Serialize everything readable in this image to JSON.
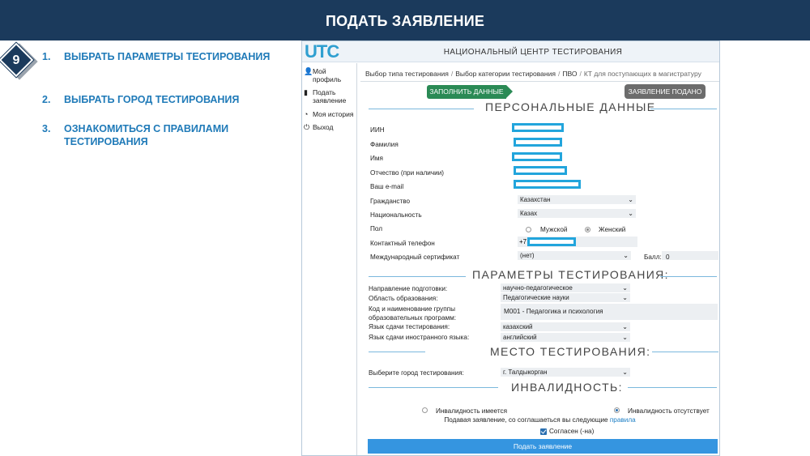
{
  "slide": {
    "title": "ПОДАТЬ ЗАЯВЛЕНИЕ",
    "step_number": "9",
    "steps": [
      {
        "num": "1.",
        "text": "ВЫБРАТЬ ПАРАМЕТРЫ ТЕСТИРОВАНИЯ"
      },
      {
        "num": "2.",
        "text": "ВЫБРАТЬ ГОРОД ТЕСТИРОВАНИЯ"
      },
      {
        "num": "3.",
        "text": "ОЗНАКОМИТЬСЯ С ПРАВИЛАМИ ТЕСТИРОВАНИЯ"
      }
    ],
    "accent_color": "#1b3a5c",
    "step_color": "#1f7ab8"
  },
  "app": {
    "logo": "UTC",
    "header_title": "НАЦИОНАЛЬНЫЙ ЦЕНТР ТЕСТИРОВАНИЯ",
    "sidebar": [
      {
        "icon": "user-icon",
        "glyph": "👤",
        "label": "Мой профиль"
      },
      {
        "icon": "document-icon",
        "glyph": "▮",
        "label": "Подать заявление"
      },
      {
        "icon": "history-icon",
        "glyph": "◔",
        "label": "Моя история"
      },
      {
        "icon": "power-icon",
        "glyph": "⏻",
        "label": "Выход"
      }
    ],
    "breadcrumbs": [
      "Выбор типа тестирования",
      "Выбор категории тестирования",
      "ПВО",
      "КТ для поступающих в магистратуру"
    ],
    "btn_fill": "ЗАПОЛНИТЬ ДАННЫЕ",
    "btn_submitted": "ЗАЯВЛЕНИЕ ПОДАНО",
    "personal": {
      "title": "ПЕРСОНАЛЬНЫЕ ДАННЫЕ",
      "iin_label": "ИИН",
      "surname_label": "Фамилия",
      "name_label": "Имя",
      "patronymic_label": "Отчество (при наличии)",
      "email_label": "Ваш e-mail",
      "citizenship_label": "Гражданство",
      "citizenship_value": "Казахстан",
      "nationality_label": "Национальность",
      "nationality_value": "Казах",
      "gender_label": "Пол",
      "gender_male": "Мужской",
      "gender_female": "Женский",
      "phone_label": "Контактный телефон",
      "phone_prefix": "+7",
      "cert_label": "Международный сертификат",
      "cert_value": "(нет)",
      "score_label": "Балл:",
      "score_value": "0"
    },
    "params": {
      "title": "ПАРАМЕТРЫ ТЕСТИРОВАНИЯ:",
      "direction_label": "Направление подготовки:",
      "direction_value": "научно-педагогическое",
      "area_label": "Область образования:",
      "area_value": "Педагогические науки",
      "group_label_1": "Код и наименование группы",
      "group_label_2": "образовательных программ:",
      "group_value": "M001 - Педагогика и психология",
      "lang_label": "Язык сдачи тестирования:",
      "lang_value": "казахский",
      "foreign_label": "Язык сдачи иностранного языка:",
      "foreign_value": "английский"
    },
    "place": {
      "title": "МЕСТО ТЕСТИРОВАНИЯ:",
      "city_label": "Выберите город тестирования:",
      "city_value": "г. Талдыкорган"
    },
    "disability": {
      "title": "ИНВАЛИДНОСТЬ:",
      "has": "Инвалидность имеется",
      "none": "Инвалидность отсутствует"
    },
    "agree_text": "Подавая заявление, со соглашаеться вы следующие",
    "agree_link": "правила",
    "agree_checkbox": "Согласен (-на)",
    "submit": "Подать заявление"
  }
}
